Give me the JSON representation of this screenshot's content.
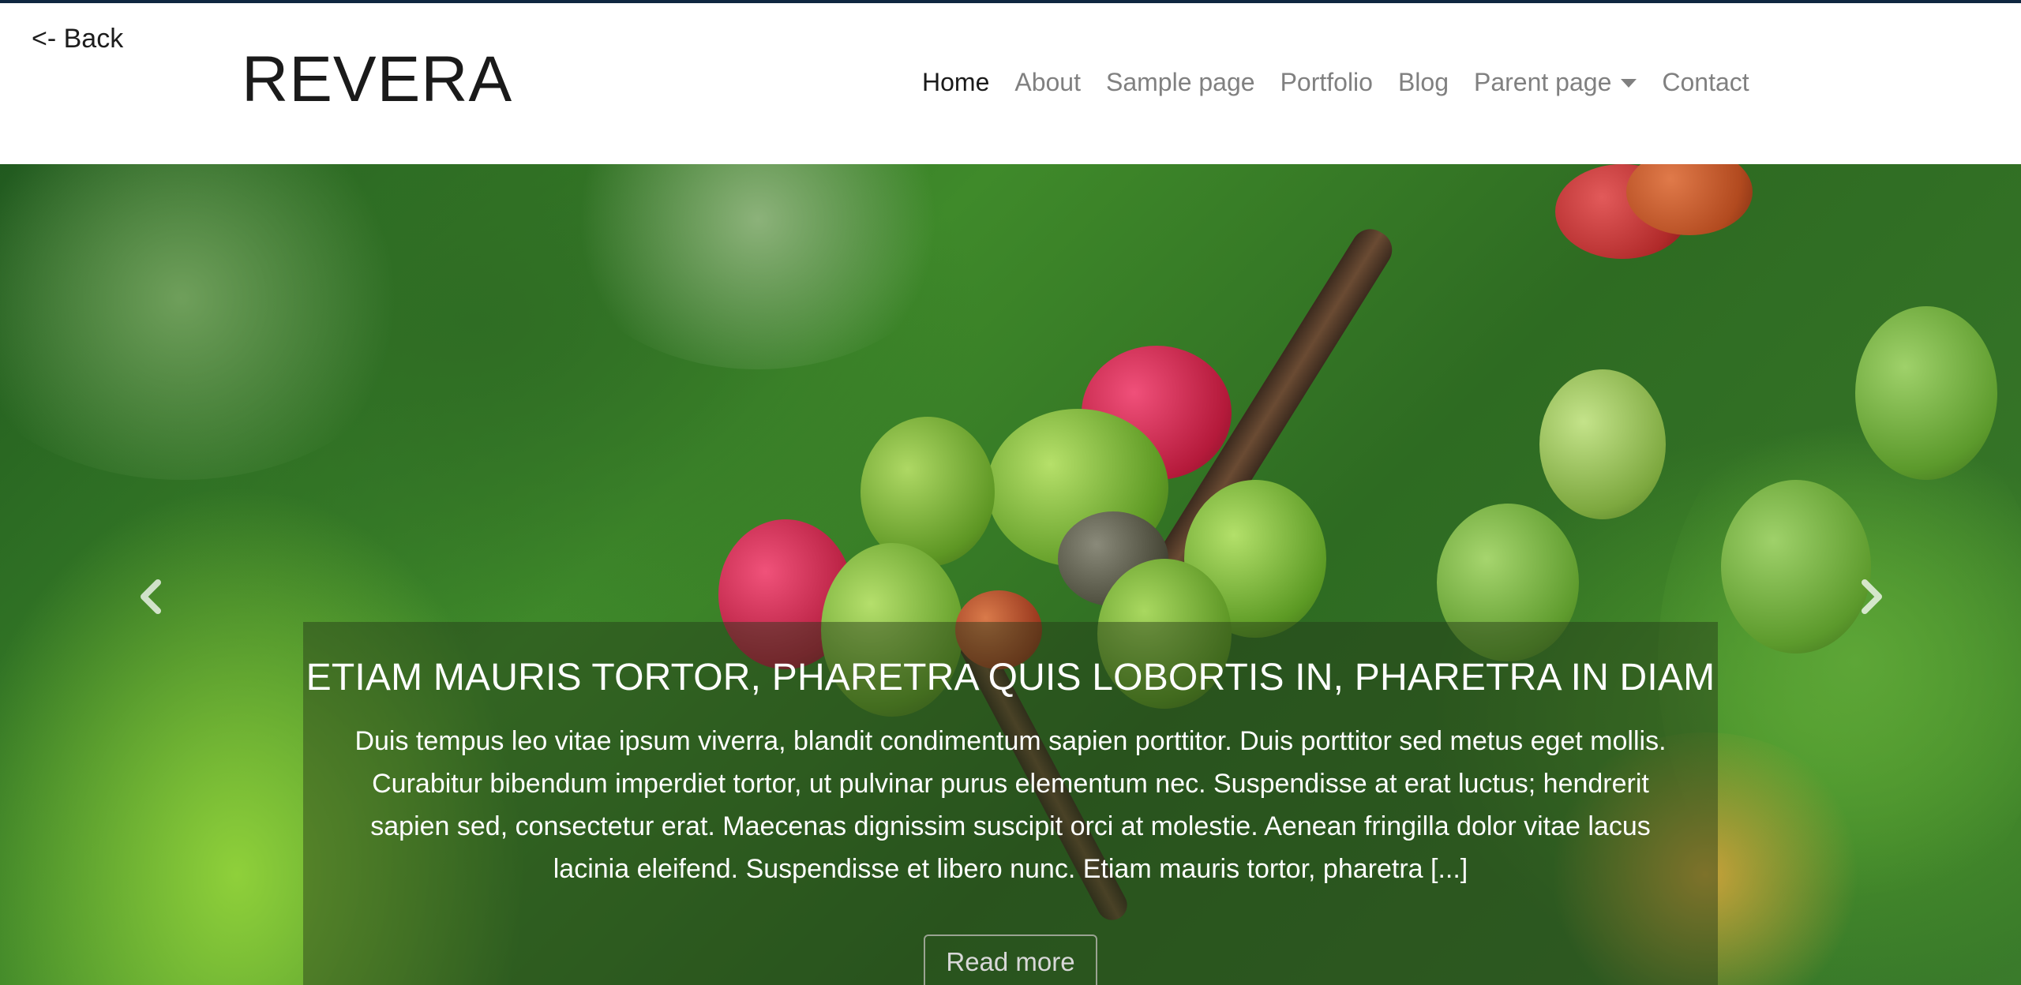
{
  "back": {
    "label": "<- Back"
  },
  "brand": {
    "name": "REVERA"
  },
  "nav": {
    "items": [
      {
        "label": "Home",
        "active": true
      },
      {
        "label": "About"
      },
      {
        "label": "Sample page"
      },
      {
        "label": "Portfolio"
      },
      {
        "label": "Blog"
      },
      {
        "label": "Parent page",
        "dropdown": true
      },
      {
        "label": "Contact"
      }
    ]
  },
  "hero": {
    "title": "ETIAM MAURIS TORTOR, PHARETRA QUIS LOBORTIS IN, PHARETRA IN DIAM",
    "text": "Duis tempus leo vitae ipsum viverra, blandit condimentum sapien porttitor. Duis porttitor sed metus eget mollis. Curabitur bibendum imperdiet tortor, ut pulvinar purus elementum nec. Suspendisse at erat luctus; hendrerit sapien sed, consectetur erat. Maecenas dignissim suscipit orci at molestie. Aenean fringilla dolor vitae lacus lacinia eleifend. Suspendisse et libero nunc. Etiam mauris tortor, pharetra [...]",
    "button": "Read more",
    "prev_icon": "chevron-left-icon",
    "next_icon": "chevron-right-icon"
  },
  "colors": {
    "border_top": "#0f2740",
    "nav_active": "#1a1a1a",
    "nav_inactive": "#808080",
    "caption_bg": "rgba(35,55,25,0.45)"
  }
}
